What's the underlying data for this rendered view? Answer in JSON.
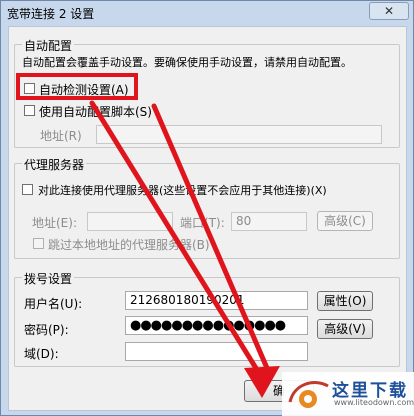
{
  "window": {
    "title": "宽带连接 2 设置",
    "close_label": "✕"
  },
  "auto_config": {
    "group_label": "自动配置",
    "description": "自动配置会覆盖手动设置。要确保使用手动设置，请禁用自动配置。",
    "auto_detect_label": "自动检测设置(A)",
    "auto_detect_checked": false,
    "use_script_label": "使用自动配置脚本(S)",
    "use_script_checked": false,
    "address_label": "地址(R)",
    "address_value": ""
  },
  "proxy": {
    "group_label": "代理服务器",
    "use_proxy_label": "对此连接使用代理服务器(这些设置不会应用于其他连接)(X)",
    "use_proxy_checked": false,
    "address_label": "地址(E):",
    "address_value": "",
    "port_label": "端口(T):",
    "port_value": "80",
    "advanced_label": "高级(C)",
    "bypass_label": "跳过本地地址的代理服务器(B)",
    "bypass_checked": false
  },
  "dialup": {
    "group_label": "拨号设置",
    "username_label": "用户名(U):",
    "username_value": "212680180190201",
    "properties_label": "属性(O)",
    "password_label": "密码(P):",
    "password_value": "●●●●●●●●●●●●●●●",
    "advanced_label": "高级(V)",
    "domain_label": "域(D):",
    "domain_value": ""
  },
  "footer": {
    "ok_label": "确"
  },
  "annotation": {
    "highlight_color": "#e0141c"
  },
  "watermark": {
    "text": "这里下载",
    "url": "www.liteodown.com"
  }
}
